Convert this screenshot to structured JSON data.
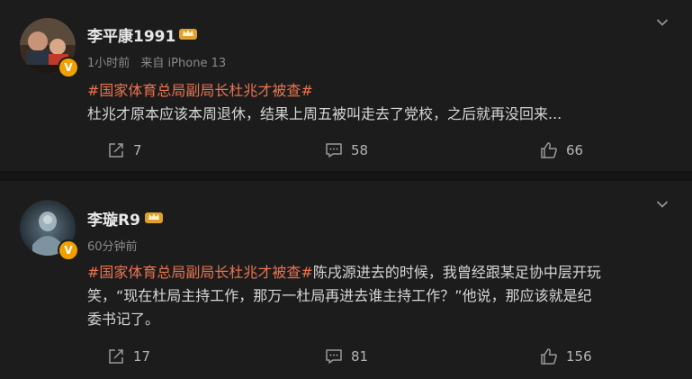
{
  "posts": [
    {
      "username": "李平康1991",
      "time": "1小时前",
      "source": "来自 iPhone 13",
      "topic": "#国家体育总局副局长杜兆才被查#",
      "lines": [
        "杜兆才原本应该本周退休，结果上周五被叫走去了党校，之后就再没回来..."
      ],
      "reposts": "7",
      "comments": "58",
      "likes": "66"
    },
    {
      "username": "李璇R9",
      "time": "60分钟前",
      "topic": "#国家体育总局副局长杜兆才被查#",
      "lines": [
        "陈戌源进去的时候，我曾经跟某足协中层开玩",
        "笑，“现在杜局主持工作，那万一杜局再进去谁主持工作？”他说，那应该就是纪",
        "委书记了。"
      ],
      "reposts": "17",
      "comments": "81",
      "likes": "156"
    }
  ],
  "colors": {
    "topic": "#eb7350",
    "verified_badge": "#f0a000",
    "card_bg": "#1c1c1c",
    "page_bg": "#141414"
  },
  "icons": {
    "verified": "V",
    "member": "crown-icon",
    "more": "chevron-down-icon",
    "repost": "share-icon",
    "comment": "comment-icon",
    "like": "thumbs-up-icon"
  }
}
